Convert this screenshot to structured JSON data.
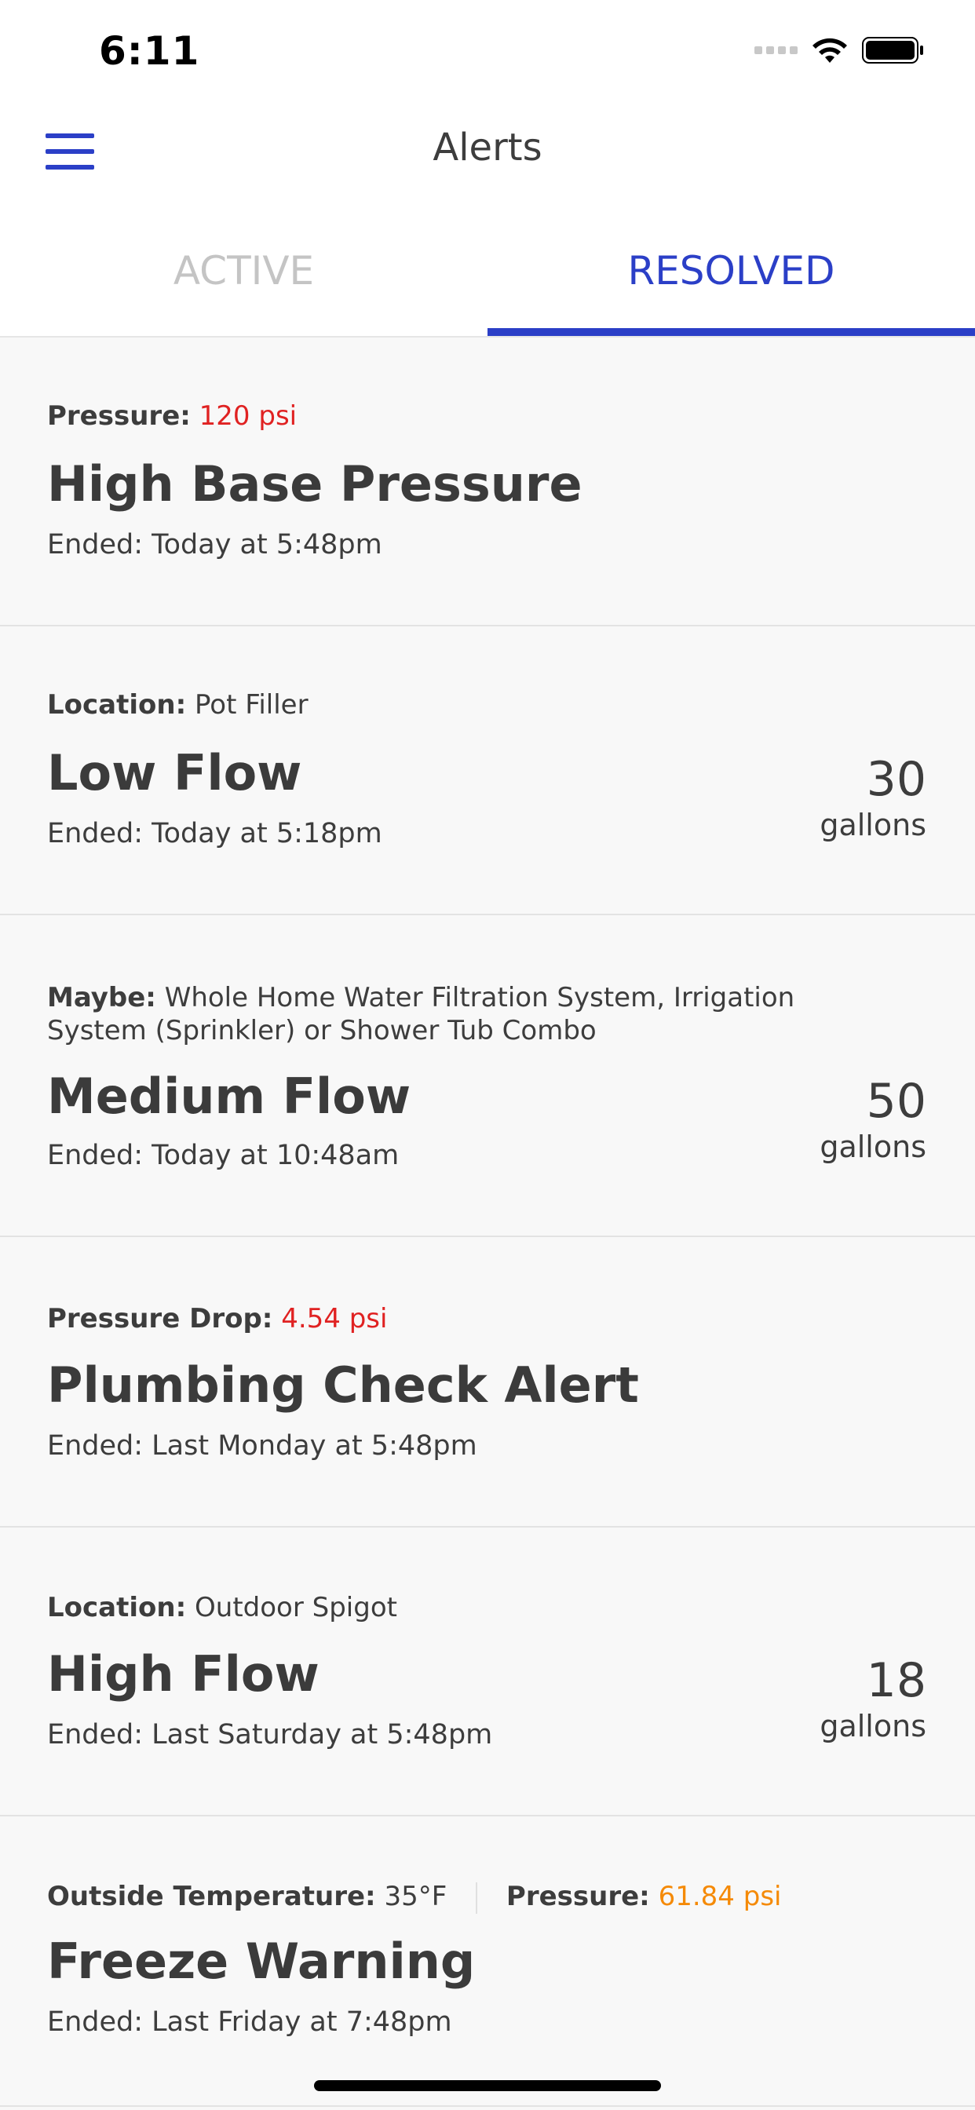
{
  "status_bar": {
    "time": "6:11"
  },
  "nav": {
    "title": "Alerts"
  },
  "tabs": [
    {
      "label": "ACTIVE"
    },
    {
      "label": "RESOLVED"
    }
  ],
  "alerts": [
    {
      "meta_label": "Pressure:",
      "meta_value": "120 psi",
      "title": "High Base Pressure",
      "ended": "Ended: Today at 5:48pm"
    },
    {
      "meta_label": "Location:",
      "meta_value": "Pot Filler",
      "title": "Low Flow",
      "ended": "Ended: Today at 5:18pm",
      "amount": "30",
      "unit": "gallons"
    },
    {
      "meta_label": "Maybe:",
      "meta_value": "Whole Home Water Filtration System, Irrigation",
      "meta_value_line2": "System (Sprinkler) or Shower Tub Combo",
      "title": "Medium Flow",
      "ended": "Ended: Today at 10:48am",
      "amount": "50",
      "unit": "gallons"
    },
    {
      "meta_label": "Pressure Drop:",
      "meta_value": "4.54 psi",
      "title": "Plumbing Check Alert",
      "ended": "Ended: Last Monday at 5:48pm"
    },
    {
      "meta_label": "Location:",
      "meta_value": "Outdoor Spigot",
      "title": "High Flow",
      "ended": "Ended: Last Saturday at 5:48pm",
      "amount": "18",
      "unit": "gallons"
    },
    {
      "meta_label": "Outside Temperature:",
      "meta_value": "35°F",
      "meta_label2": "Pressure:",
      "meta_value2": "61.84 psi",
      "title": "Freeze Warning",
      "ended": "Ended: Last Friday at 7:48pm"
    }
  ],
  "colors": {
    "accent": "#2b3fc7",
    "alert_red": "#e02222",
    "alert_orange": "#f58a07"
  }
}
